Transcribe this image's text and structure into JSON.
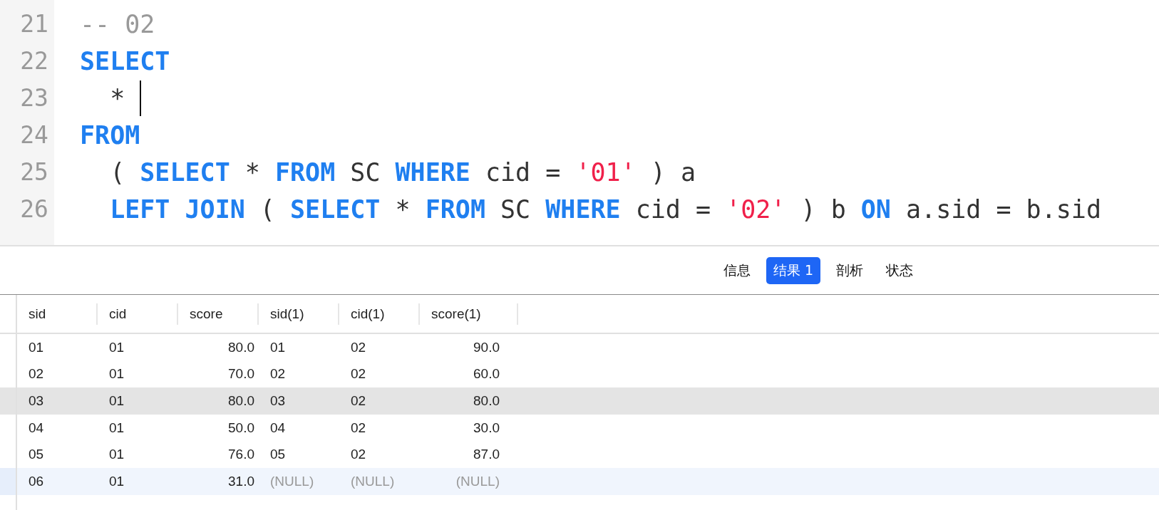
{
  "editor": {
    "lines": [
      {
        "number": "21",
        "cursor": false,
        "tokens": [
          {
            "kind": "comment",
            "text": "-- 02"
          }
        ]
      },
      {
        "number": "22",
        "cursor": false,
        "tokens": [
          {
            "kind": "keyword",
            "text": "SELECT"
          }
        ]
      },
      {
        "number": "23",
        "cursor": true,
        "tokens": [
          {
            "kind": "plain",
            "text": "  * "
          }
        ]
      },
      {
        "number": "24",
        "cursor": false,
        "tokens": [
          {
            "kind": "keyword",
            "text": "FROM"
          }
        ]
      },
      {
        "number": "25",
        "cursor": false,
        "tokens": [
          {
            "kind": "plain",
            "text": "  ( "
          },
          {
            "kind": "keyword",
            "text": "SELECT"
          },
          {
            "kind": "plain",
            "text": " * "
          },
          {
            "kind": "keyword",
            "text": "FROM"
          },
          {
            "kind": "plain",
            "text": " SC "
          },
          {
            "kind": "keyword",
            "text": "WHERE"
          },
          {
            "kind": "plain",
            "text": " cid = "
          },
          {
            "kind": "string",
            "text": "'01'"
          },
          {
            "kind": "plain",
            "text": " ) a"
          }
        ]
      },
      {
        "number": "26",
        "cursor": false,
        "tokens": [
          {
            "kind": "keyword",
            "text": "  LEFT JOIN"
          },
          {
            "kind": "plain",
            "text": " ( "
          },
          {
            "kind": "keyword",
            "text": "SELECT"
          },
          {
            "kind": "plain",
            "text": " * "
          },
          {
            "kind": "keyword",
            "text": "FROM"
          },
          {
            "kind": "plain",
            "text": " SC "
          },
          {
            "kind": "keyword",
            "text": "WHERE"
          },
          {
            "kind": "plain",
            "text": " cid = "
          },
          {
            "kind": "string",
            "text": "'02'"
          },
          {
            "kind": "plain",
            "text": " ) b "
          },
          {
            "kind": "keyword",
            "text": "ON"
          },
          {
            "kind": "plain",
            "text": " a.sid = b.sid"
          }
        ]
      }
    ]
  },
  "tabs": [
    {
      "label": "信息",
      "selected": false
    },
    {
      "label": "结果 1",
      "selected": true
    },
    {
      "label": "剖析",
      "selected": false
    },
    {
      "label": "状态",
      "selected": false
    }
  ],
  "table": {
    "columns": [
      {
        "label": "sid"
      },
      {
        "label": "cid"
      },
      {
        "label": "score"
      },
      {
        "label": "sid(1)"
      },
      {
        "label": "cid(1)"
      },
      {
        "label": "score(1)"
      }
    ],
    "rows": [
      {
        "hovered": false,
        "selected": false,
        "cells": [
          {
            "text": "01",
            "null": false
          },
          {
            "text": "01",
            "null": false
          },
          {
            "text": "80.0",
            "null": false
          },
          {
            "text": "01",
            "null": false
          },
          {
            "text": "02",
            "null": false
          },
          {
            "text": "90.0",
            "null": false
          }
        ]
      },
      {
        "hovered": false,
        "selected": false,
        "cells": [
          {
            "text": "02",
            "null": false
          },
          {
            "text": "01",
            "null": false
          },
          {
            "text": "70.0",
            "null": false
          },
          {
            "text": "02",
            "null": false
          },
          {
            "text": "02",
            "null": false
          },
          {
            "text": "60.0",
            "null": false
          }
        ]
      },
      {
        "hovered": true,
        "selected": false,
        "cells": [
          {
            "text": "03",
            "null": false
          },
          {
            "text": "01",
            "null": false
          },
          {
            "text": "80.0",
            "null": false
          },
          {
            "text": "03",
            "null": false
          },
          {
            "text": "02",
            "null": false
          },
          {
            "text": "80.0",
            "null": false
          }
        ]
      },
      {
        "hovered": false,
        "selected": false,
        "cells": [
          {
            "text": "04",
            "null": false
          },
          {
            "text": "01",
            "null": false
          },
          {
            "text": "50.0",
            "null": false
          },
          {
            "text": "04",
            "null": false
          },
          {
            "text": "02",
            "null": false
          },
          {
            "text": "30.0",
            "null": false
          }
        ]
      },
      {
        "hovered": false,
        "selected": false,
        "cells": [
          {
            "text": "05",
            "null": false
          },
          {
            "text": "01",
            "null": false
          },
          {
            "text": "76.0",
            "null": false
          },
          {
            "text": "05",
            "null": false
          },
          {
            "text": "02",
            "null": false
          },
          {
            "text": "87.0",
            "null": false
          }
        ]
      },
      {
        "hovered": false,
        "selected": true,
        "cells": [
          {
            "text": "06",
            "null": false
          },
          {
            "text": "01",
            "null": false
          },
          {
            "text": "31.0",
            "null": false
          },
          {
            "text": "(NULL)",
            "null": true
          },
          {
            "text": "(NULL)",
            "null": true
          },
          {
            "text": "(NULL)",
            "null": true
          }
        ]
      }
    ]
  }
}
